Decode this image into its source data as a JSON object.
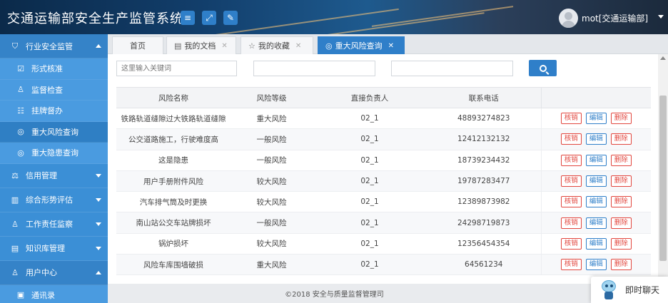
{
  "header": {
    "title": "交通运输部安全生产监管系统",
    "buttons": [
      {
        "name": "menu-toggle-button",
        "icon": "hamburger-icon",
        "glyph": "≡"
      },
      {
        "name": "fullscreen-button",
        "icon": "expand-icon",
        "glyph": "⤢"
      },
      {
        "name": "edit-button",
        "icon": "edit-icon",
        "glyph": "✎"
      }
    ],
    "username": "mot[交通运输部]"
  },
  "sidebar": {
    "groups": [
      {
        "label": "行业安全监管",
        "icon": "shield-icon",
        "glyph": "⛉",
        "open": true,
        "items": [
          {
            "label": "形式核准",
            "icon": "document-check-icon",
            "glyph": "☑",
            "active": false
          },
          {
            "label": "监督检查",
            "icon": "user-icon",
            "glyph": "♙",
            "active": false
          },
          {
            "label": "挂牌督办",
            "icon": "list-icon",
            "glyph": "☷",
            "active": false
          },
          {
            "label": "重大风险查询",
            "icon": "shield-small-icon",
            "glyph": "◎",
            "active": true
          },
          {
            "label": "重大隐患查询",
            "icon": "shield-small-icon",
            "glyph": "◎",
            "active": false
          }
        ]
      },
      {
        "label": "信用管理",
        "icon": "scale-icon",
        "glyph": "⚖",
        "open": false,
        "items": []
      },
      {
        "label": "综合形势评估",
        "icon": "bar-chart-icon",
        "glyph": "▥",
        "open": false,
        "items": []
      },
      {
        "label": "工作责任监察",
        "icon": "user-icon",
        "glyph": "♙",
        "open": false,
        "items": []
      },
      {
        "label": "知识库管理",
        "icon": "book-icon",
        "glyph": "▤",
        "open": false,
        "items": []
      },
      {
        "label": "用户中心",
        "icon": "user-icon",
        "glyph": "♙",
        "open": true,
        "items": [
          {
            "label": "通讯录",
            "icon": "address-book-icon",
            "glyph": "▣",
            "active": false
          }
        ]
      }
    ]
  },
  "tabs": [
    {
      "label": "首页",
      "icon": "",
      "closable": false,
      "active": false
    },
    {
      "label": "我的文档",
      "icon": "document-icon",
      "glyph": "▤",
      "closable": true,
      "active": false
    },
    {
      "label": "我的收藏",
      "icon": "star-icon",
      "glyph": "☆",
      "closable": true,
      "active": false
    },
    {
      "label": "重大风险查询",
      "icon": "shield-small-icon",
      "glyph": "◎",
      "closable": true,
      "active": true
    }
  ],
  "search": {
    "keyword_placeholder": "这里输入关键词",
    "field2_placeholder": "",
    "field3_placeholder": ""
  },
  "table": {
    "columns": [
      "风险名称",
      "风险等级",
      "直接负责人",
      "联系电话",
      ""
    ],
    "actions": [
      "核销",
      "编辑",
      "删除"
    ],
    "rows": [
      {
        "name": "铁路轨道缝隙过大铁路轨道缝隙",
        "level": "重大风险",
        "owner": "02_1",
        "phone": "48893274823"
      },
      {
        "name": "公交道路施工，行驶难度高",
        "level": "一般风险",
        "owner": "02_1",
        "phone": "12412132132"
      },
      {
        "name": "这是隐患",
        "level": "一般风险",
        "owner": "02_1",
        "phone": "18739234432"
      },
      {
        "name": "用户手册附件风险",
        "level": "较大风险",
        "owner": "02_1",
        "phone": "19787283477"
      },
      {
        "name": "汽车排气筒及时更换",
        "level": "较大风险",
        "owner": "02_1",
        "phone": "12389873982"
      },
      {
        "name": "南山站公交车站牌损坏",
        "level": "一般风险",
        "owner": "02_1",
        "phone": "24298719873"
      },
      {
        "name": "锅炉损坏",
        "level": "较大风险",
        "owner": "02_1",
        "phone": "12356454354"
      },
      {
        "name": "风险车库围墙破损",
        "level": "重大风险",
        "owner": "02_1",
        "phone": "64561234"
      }
    ]
  },
  "footer": {
    "copyright": "©2018 安全与质量监督管理司"
  },
  "chat": {
    "label": "即时聊天"
  },
  "colors": {
    "primary": "#2f7fc9",
    "sidebar": "#3b8fd6",
    "danger": "#e2473f"
  }
}
